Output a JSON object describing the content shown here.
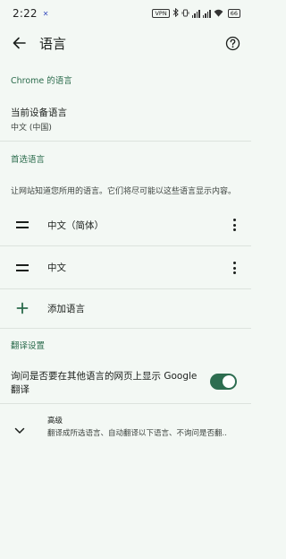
{
  "status_bar": {
    "time": "2:22",
    "indicator": "✕",
    "vpn": "VPN",
    "battery": "66"
  },
  "app_bar": {
    "title": "语言"
  },
  "chrome_section": {
    "header": "Chrome 的语言",
    "device_language_title": "当前设备语言",
    "device_language_value": "中文 (中国)"
  },
  "preferred_section": {
    "header": "首选语言",
    "description": "让网站知道您所用的语言。它们将尽可能以这些语言显示内容。",
    "languages": [
      {
        "label": "中文（简体）"
      },
      {
        "label": "中文"
      }
    ],
    "add_label": "添加语言"
  },
  "translate_section": {
    "header": "翻译设置",
    "offer_translate_line1": "询问是否要在其他语言的网页上显示 Google",
    "offer_translate_line2": "翻译",
    "offer_translate_enabled": true,
    "advanced_title": "高级",
    "advanced_summary": "翻译成所选语言、自动翻译以下语言、不询问是否翻.."
  },
  "colors": {
    "background": "#f3f8f4",
    "accent": "#2b6b4c",
    "toggle_on": "#2d6d50"
  }
}
